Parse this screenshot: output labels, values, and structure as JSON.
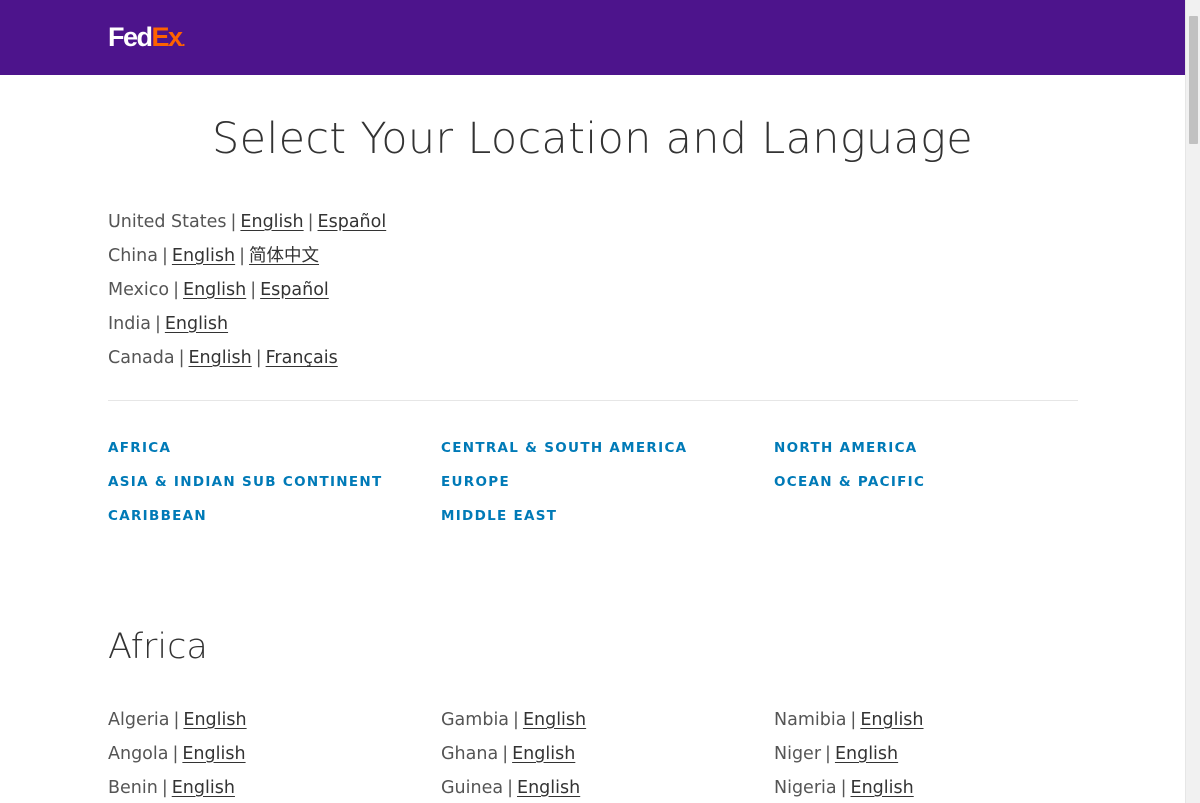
{
  "header": {
    "logo": {
      "fed": "Fed",
      "ex": "Ex",
      "dot": "."
    },
    "colors": {
      "brand_purple": "#4d148c",
      "brand_orange": "#ff6200"
    }
  },
  "page_title": "Select Your Location and Language",
  "top_locations": [
    {
      "country": "United States",
      "languages": [
        "English",
        "Español"
      ]
    },
    {
      "country": "China",
      "languages": [
        "English",
        "简体中文"
      ]
    },
    {
      "country": "Mexico",
      "languages": [
        "English",
        "Español"
      ]
    },
    {
      "country": "India",
      "languages": [
        "English"
      ]
    },
    {
      "country": "Canada",
      "languages": [
        "English",
        "Français"
      ]
    }
  ],
  "regions": {
    "col1": [
      "AFRICA",
      "ASIA & INDIAN SUB CONTINENT",
      "CARIBBEAN"
    ],
    "col2": [
      "CENTRAL & SOUTH AMERICA",
      "EUROPE",
      "MIDDLE EAST"
    ],
    "col3": [
      "NORTH AMERICA",
      "OCEAN & PACIFIC"
    ],
    "link_color": "#007ab7"
  },
  "africa": {
    "title": "Africa",
    "col1": [
      {
        "country": "Algeria",
        "language": "English"
      },
      {
        "country": "Angola",
        "language": "English"
      },
      {
        "country": "Benin",
        "language": "English"
      }
    ],
    "col2": [
      {
        "country": "Gambia",
        "language": "English"
      },
      {
        "country": "Ghana",
        "language": "English"
      },
      {
        "country": "Guinea",
        "language": "English"
      }
    ],
    "col3": [
      {
        "country": "Namibia",
        "language": "English"
      },
      {
        "country": "Niger",
        "language": "English"
      },
      {
        "country": "Nigeria",
        "language": "English"
      }
    ]
  },
  "separator": "|"
}
